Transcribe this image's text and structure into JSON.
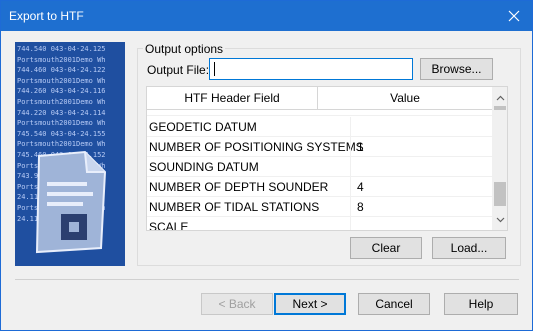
{
  "window": {
    "title": "Export to HTF"
  },
  "icons": {
    "close": "close-icon",
    "scroll_up": "chevron-up-icon",
    "scroll_down": "chevron-down-icon",
    "doc": "document-icon"
  },
  "colors": {
    "titlebar": "#1e6fd0",
    "accent": "#0078d7",
    "dialog_bg": "#f0f0f0"
  },
  "side_image": {
    "text": "744.540 043-04-24.125\nPortsmouth2001Demo Wh\n744.460 043-04-24.122\nPortsmouth2001Demo Wh\n744.260 043-04-24.116\nPortsmouth2001Demo Wh\n744.220 043-04-24.114\nPortsmouth2001Demo Wh\n745.540 043-04-24.155\nPortsmouth2001Demo Wh\n745.460 043-04-24.152\nPortsmouth2001Demo Wh\n743.960 043-04-24.101\nPortsmouth2001Demo Wh\n24.113\nPortsmouth2001Demo Wh\n24.113"
  },
  "output_options": {
    "legend": "Output options",
    "output_file_label": "Output File:",
    "output_file_value": "",
    "browse_label": "Browse..."
  },
  "grid": {
    "headers": [
      "HTF Header Field",
      "Value"
    ],
    "rows": [
      {
        "field": "GEODETIC DATUM",
        "value": ""
      },
      {
        "field": "NUMBER OF POSITIONING SYSTEMS",
        "value": "1"
      },
      {
        "field": "SOUNDING DATUM",
        "value": ""
      },
      {
        "field": "NUMBER OF DEPTH SOUNDER",
        "value": "4"
      },
      {
        "field": "NUMBER OF TIDAL STATIONS",
        "value": "8"
      },
      {
        "field": "SCALE",
        "value": ""
      }
    ]
  },
  "actions": {
    "clear": "Clear",
    "load": "Load..."
  },
  "footer": {
    "back": "< Back",
    "next": "Next >",
    "cancel": "Cancel",
    "help": "Help"
  }
}
